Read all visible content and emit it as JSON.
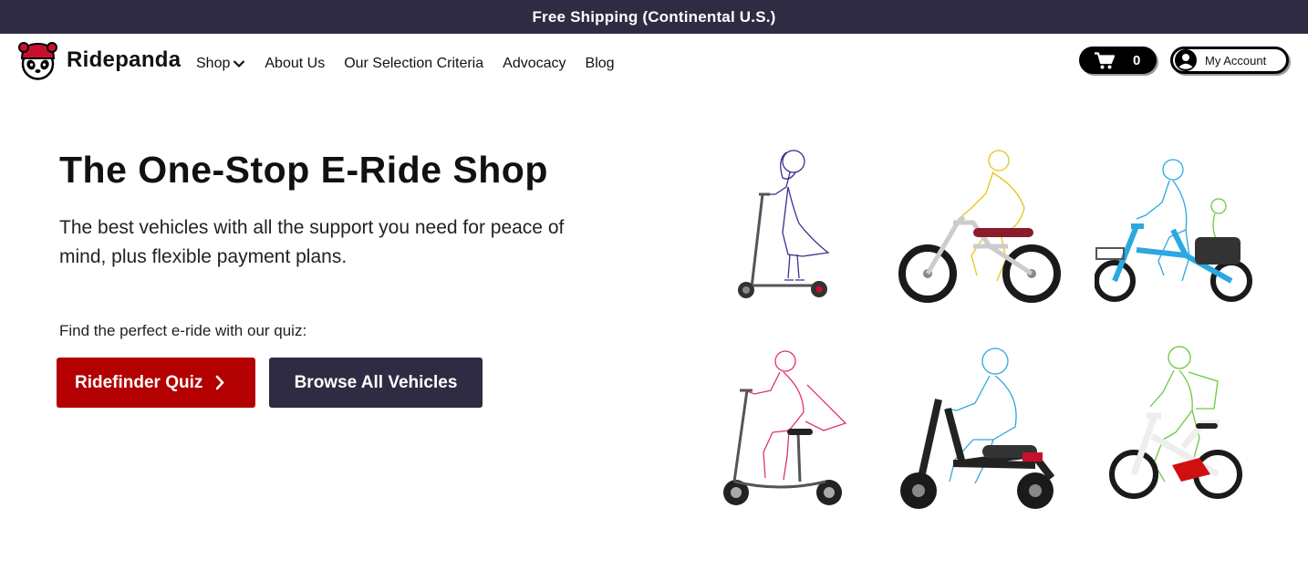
{
  "announcement": {
    "text": "Free Shipping (Continental U.S.)"
  },
  "header": {
    "brand": "Ridepanda",
    "nav": [
      {
        "label": "Shop",
        "has_dropdown": true
      },
      {
        "label": "About Us"
      },
      {
        "label": "Our Selection Criteria"
      },
      {
        "label": "Advocacy"
      },
      {
        "label": "Blog"
      }
    ],
    "cart": {
      "count": "0",
      "icon": "cart-icon"
    },
    "account": {
      "label": "My Account",
      "icon": "user-icon"
    }
  },
  "hero": {
    "title": "The One-Stop E-Ride Shop",
    "subtitle": "The best vehicles with all the support you need for peace of mind, plus flexible payment plans.",
    "quiz_prompt": "Find the perfect e-ride with our quiz:",
    "quiz_button": "Ridefinder Quiz",
    "browse_button": "Browse All Vehicles"
  },
  "vehicles": [
    {
      "type": "kick-scooter",
      "rider_color": "#3b2f8f"
    },
    {
      "type": "moped-style-ebike",
      "rider_color": "#e6c619"
    },
    {
      "type": "cargo-ebike",
      "rider_color": "#2aa8e0"
    },
    {
      "type": "seated-scooter",
      "rider_color": "#e0336b"
    },
    {
      "type": "electric-moped",
      "rider_color": "#2aa8e0"
    },
    {
      "type": "folding-ebike",
      "rider_color": "#6ac93f"
    }
  ],
  "colors": {
    "announcement_bg": "#2f2b42",
    "quiz_button": "#b30000",
    "browse_button": "#2f2b42",
    "panda_helmet": "#c8102e"
  }
}
